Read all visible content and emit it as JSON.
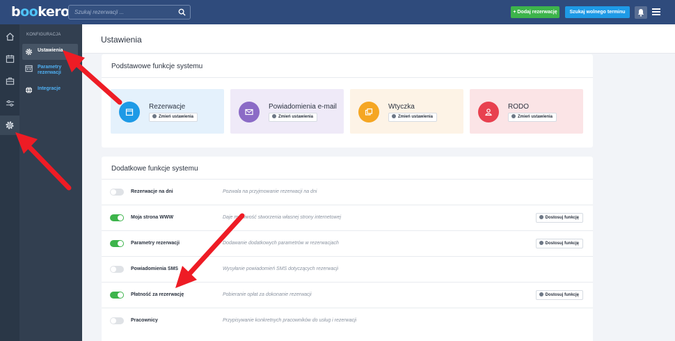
{
  "topbar": {
    "logo_main": "b",
    "logo_rest": "kero",
    "logo_dot": "oo",
    "search_placeholder": "Szukaj rezerwacji ...",
    "add_button": "+ Dodaj rezerwację",
    "find_button": "Szukaj wolnego terminu"
  },
  "rail": {
    "icons": [
      "home-icon",
      "calendar-icon",
      "briefcase-icon",
      "sliders-icon",
      "gear-icon"
    ]
  },
  "subnav": {
    "heading": "KONFIGURACJA",
    "items": [
      {
        "label": "Ustawienia",
        "icon": "gear-icon"
      },
      {
        "label": "Parametry rezerwacji",
        "icon": "calendar-icon"
      },
      {
        "label": "Integracje",
        "icon": "globe-icon"
      }
    ]
  },
  "page": {
    "title": "Ustawienia"
  },
  "basic": {
    "title": "Podstawowe funkcje systemu",
    "features": [
      {
        "name": "Rezerwacje",
        "button": "Zmień ustawienia",
        "bg": "#e4f1fc",
        "circle": "#1e9ae6"
      },
      {
        "name": "Powiadomienia e-mail",
        "button": "Zmień ustawienia",
        "bg": "#efeaf8",
        "circle": "#8b6bc6"
      },
      {
        "name": "Wtyczka",
        "button": "Zmień ustawienia",
        "bg": "#fdf3e6",
        "circle": "#f5a623"
      },
      {
        "name": "RODO",
        "button": "Zmień ustawienia",
        "bg": "#fbe4e6",
        "circle": "#e8414f"
      }
    ]
  },
  "extra": {
    "title": "Dodatkowe funkcje systemu",
    "rows": [
      {
        "name": "Rezerwacje na dni",
        "desc": "Pozwala na przyjmowanie rezerwacji na dni",
        "enabled": false,
        "button": ""
      },
      {
        "name": "Moja strona WWW",
        "desc": "Daje możliwość stworzenia własnej strony internetowej",
        "enabled": true,
        "button": "Dostosuj funkcję"
      },
      {
        "name": "Parametry rezerwacji",
        "desc": "Dodawanie dodatkowych parametrów w rezerwacjach",
        "enabled": true,
        "button": "Dostosuj funkcję"
      },
      {
        "name": "Powiadomienia SMS",
        "desc": "Wysyłanie powiadomień SMS dotyczących rezerwacji",
        "enabled": false,
        "button": ""
      },
      {
        "name": "Płatność za rezerwację",
        "desc": "Pobieranie opłat za dokonanie rezerwacji",
        "enabled": true,
        "button": "Dostosuj funkcję"
      },
      {
        "name": "Pracownicy",
        "desc": "Przypisywanie konkretnych pracowników do usług i rezerwacji",
        "enabled": false,
        "button": ""
      }
    ]
  },
  "colors": {
    "topbar": "#2f4b7c",
    "accent_green": "#3db44b",
    "accent_blue": "#1e9ae6",
    "arrow": "#ee1c25"
  }
}
